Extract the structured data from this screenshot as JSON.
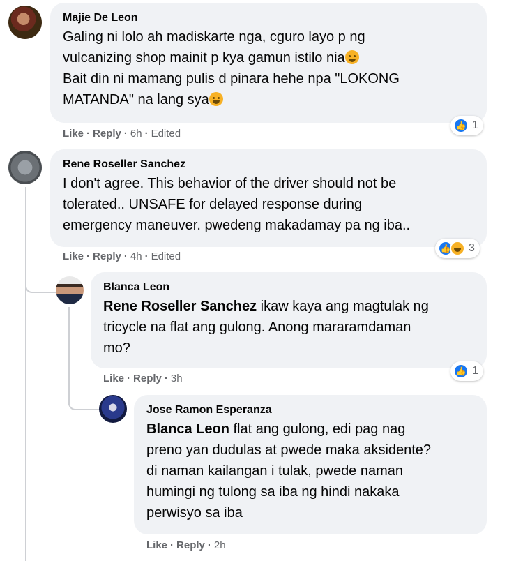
{
  "comments": [
    {
      "author": "Majie De Leon",
      "lines": [
        "Galing ni lolo ah madiskarte nga, cguro layo p ng",
        "vulcanizing shop mainit p kya gamun istilo nia",
        "Bait din ni mamang pulis d pinara hehe npa \"LOKONG",
        "MATANDA\" na lang sya"
      ],
      "like": "Like",
      "reply": "Reply",
      "time": "6h",
      "edited": "Edited",
      "reaction_count": "1"
    },
    {
      "author": "Rene Roseller Sanchez",
      "lines": [
        "I don't agree. This behavior of the driver should not be",
        "tolerated.. UNSAFE for delayed response during",
        "emergency maneuver. pwedeng makadamay pa ng iba.."
      ],
      "like": "Like",
      "reply": "Reply",
      "time": "4h",
      "edited": "Edited",
      "reaction_count": "3"
    },
    {
      "author": "Blanca Leon",
      "mention": "Rene Roseller Sanchez",
      "lines": [
        " ikaw kaya ang magtulak ng",
        "tricycle na flat ang gulong. Anong mararamdaman",
        "mo?"
      ],
      "like": "Like",
      "reply": "Reply",
      "time": "3h",
      "reaction_count": "1"
    },
    {
      "author": "Jose Ramon Esperanza",
      "mention": "Blanca Leon",
      "lines": [
        " flat ang gulong, edi pag nag",
        "preno yan dudulas at pwede maka aksidente?",
        "di naman kailangan i tulak, pwede naman",
        "humingi ng tulong sa iba ng hindi nakaka",
        "perwisyo sa iba"
      ],
      "like": "Like",
      "reply": "Reply",
      "time": "2h"
    }
  ],
  "separator": "·"
}
